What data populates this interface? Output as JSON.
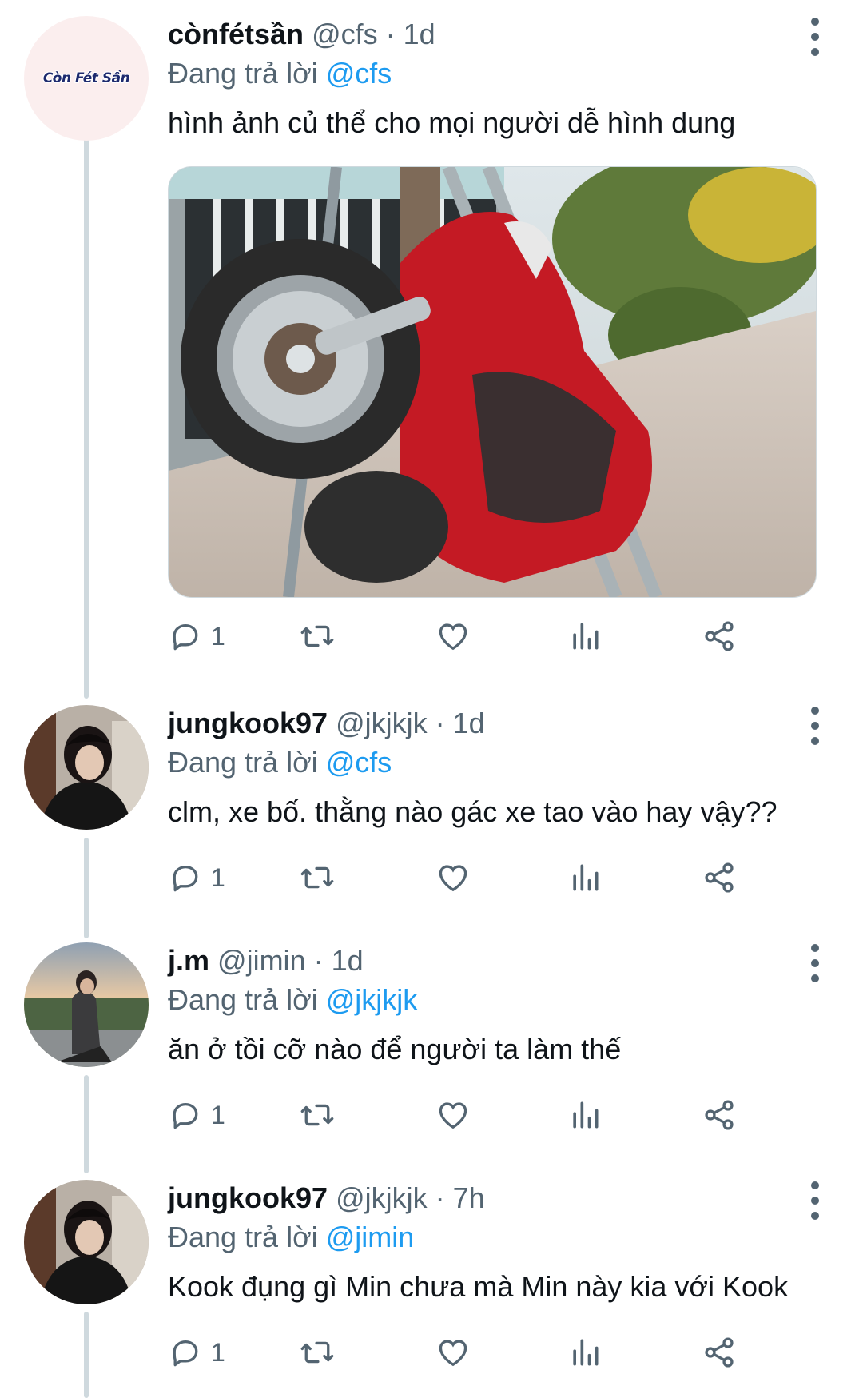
{
  "tweets": [
    {
      "display_name": "cònfétsần",
      "handle": "@cfs",
      "separator": "·",
      "time": "1d",
      "replying_prefix": "Đang trả lời",
      "replying_to": "@cfs",
      "text": "hình ảnh củ thể cho mọi người dễ hình dung",
      "avatar_text": "Còn Fét Sần",
      "reply_count": "1",
      "has_media": true
    },
    {
      "display_name": "jungkook97",
      "handle": "@jkjkjk",
      "separator": "·",
      "time": "1d",
      "replying_prefix": "Đang trả lời",
      "replying_to": "@cfs",
      "text": "clm, xe bố. thằng nào gác xe tao vào hay vậy??",
      "reply_count": "1"
    },
    {
      "display_name": "j.m",
      "handle": "@jimin",
      "separator": "·",
      "time": "1d",
      "replying_prefix": "Đang trả lời",
      "replying_to": "@jkjkjk",
      "text": "ăn ở tồi cỡ nào để người ta làm thế",
      "reply_count": "1"
    },
    {
      "display_name": "jungkook97",
      "handle": "@jkjkjk",
      "separator": "·",
      "time": "7h",
      "replying_prefix": "Đang trả lời",
      "replying_to": "@jimin",
      "text": "Kook đụng gì Min chưa mà Min này kia với Kook",
      "reply_count": "1"
    }
  ],
  "icons": [
    "reply-icon",
    "retweet-icon",
    "like-icon",
    "views-icon",
    "share-icon",
    "more-icon"
  ],
  "colors": {
    "mention": "#1d9bf0",
    "muted": "#536471",
    "thread_line": "#cfd9de",
    "bike_red": "#c41a24"
  }
}
